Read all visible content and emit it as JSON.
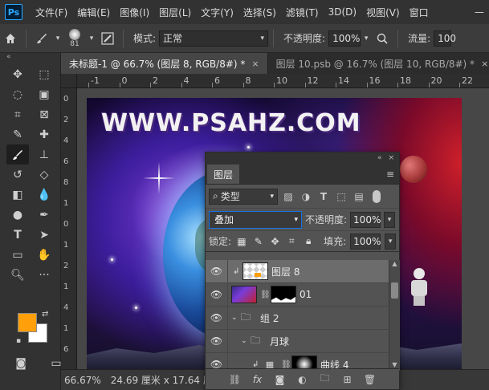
{
  "menubar": {
    "logo": "Ps",
    "items": [
      "文件(F)",
      "编辑(E)",
      "图像(I)",
      "图层(L)",
      "文字(Y)",
      "选择(S)",
      "滤镜(T)",
      "3D(D)",
      "视图(V)",
      "窗口"
    ],
    "minimize": "—"
  },
  "options": {
    "brush_size": "81",
    "mode_label": "模式:",
    "mode_value": "正常",
    "opacity_label": "不透明度:",
    "opacity_value": "100%",
    "flow_label": "流量:",
    "flow_value": "100"
  },
  "tabs": [
    {
      "label": "未标题-1 @ 66.7% (图层 8, RGB/8#) *",
      "close": "×"
    },
    {
      "label": "图层 10.psb @ 16.7% (图层 10, RGB/8#) *",
      "close": "×"
    }
  ],
  "ruler": {
    "top_labels": [
      "-1",
      "0",
      "2",
      "4",
      "6",
      "8",
      "10",
      "12",
      "14",
      "16",
      "18",
      "20",
      "22",
      "24"
    ],
    "left_labels": [
      "0",
      "2",
      "4",
      "6",
      "8",
      "1",
      "0",
      "1",
      "2",
      "1",
      "4",
      "1",
      "6"
    ]
  },
  "canvas": {
    "watermark": "WWW.PSAHZ.COM"
  },
  "status": {
    "zoom": "66.67%",
    "size": "24.69 厘米 x 17.64 厘米",
    "caret": "›"
  },
  "layers_panel": {
    "collapse_label": "«",
    "close_label": "×",
    "tab_label": "图层",
    "filter_label": "类型",
    "blend_mode": "叠加",
    "opacity_label": "不透明度:",
    "opacity_value": "100%",
    "lock_label": "锁定:",
    "fill_label": "填充:",
    "fill_value": "100%",
    "layers": [
      {
        "name": "图层 8",
        "type": "checker",
        "clipped": true,
        "selected": true
      },
      {
        "name": "01",
        "type": "photo-mask",
        "clipped": false,
        "selected": false
      },
      {
        "name": "组 2",
        "type": "group",
        "clipped": false,
        "selected": false
      },
      {
        "name": "月球",
        "type": "group-nested",
        "clipped": false,
        "selected": false
      },
      {
        "name": "曲线 4",
        "type": "curves",
        "clipped": true,
        "selected": false
      }
    ]
  },
  "colors": {
    "foreground": "#ff9f0a",
    "background": "#ffffff",
    "accent": "#1473e6"
  }
}
